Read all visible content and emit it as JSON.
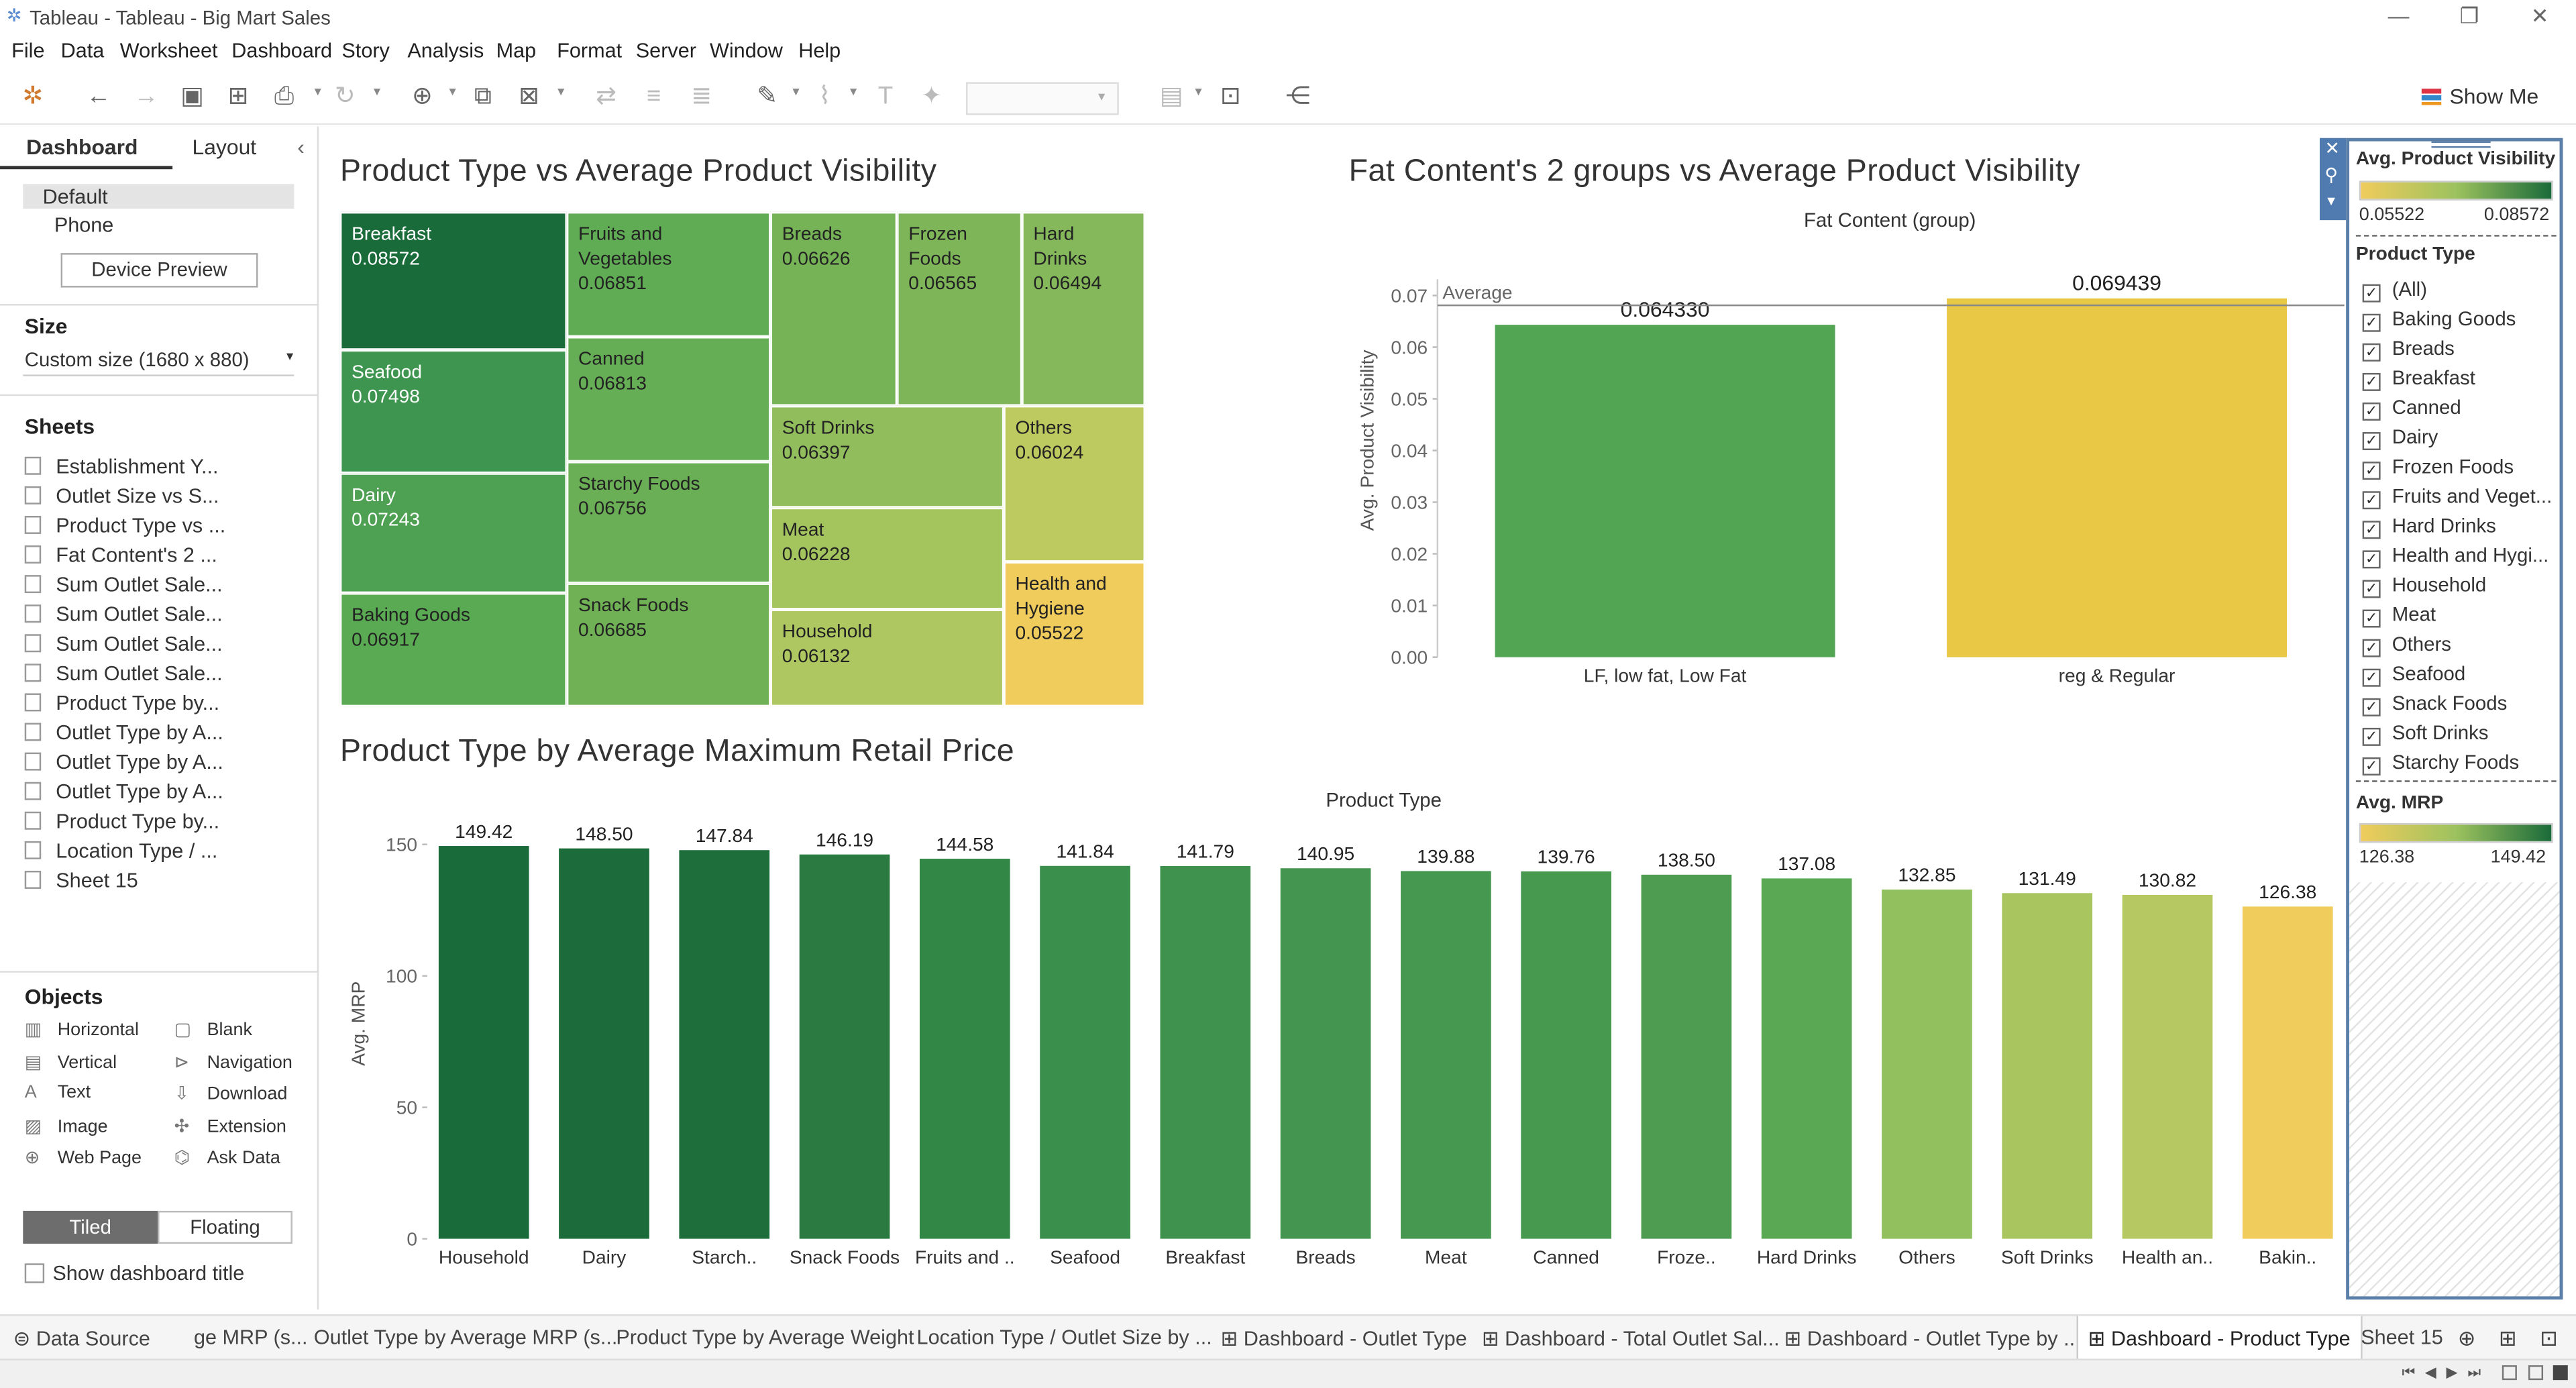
{
  "window": {
    "title": "Tableau - Tableau - Big Mart Sales"
  },
  "menu": [
    "File",
    "Data",
    "Worksheet",
    "Dashboard",
    "Story",
    "Analysis",
    "Map",
    "Format",
    "Server",
    "Window",
    "Help"
  ],
  "toolbar": {
    "show_me": "Show Me"
  },
  "left_panel": {
    "tabs": {
      "dashboard": "Dashboard",
      "layout": "Layout"
    },
    "devices": {
      "default": "Default",
      "phone": "Phone",
      "preview_button": "Device Preview"
    },
    "size": {
      "heading": "Size",
      "value": "Custom size (1680 x 880)"
    },
    "sheets_heading": "Sheets",
    "sheets": [
      "Establishment Y...",
      "Outlet Size vs S...",
      "Product Type vs ...",
      "Fat Content's 2 ...",
      "Sum Outlet Sale...",
      "Sum Outlet Sale...",
      "Sum Outlet Sale...",
      "Sum Outlet Sale...",
      "Product Type by...",
      "Outlet Type by A...",
      "Outlet Type by A...",
      "Outlet Type by A...",
      "Product Type by...",
      "Location Type / ...",
      "Sheet 15"
    ],
    "objects_heading": "Objects",
    "objects": [
      {
        "label": "Horizontal",
        "icon": "horizontal-icon"
      },
      {
        "label": "Blank",
        "icon": "blank-icon"
      },
      {
        "label": "Vertical",
        "icon": "vertical-icon"
      },
      {
        "label": "Navigation",
        "icon": "navigation-icon"
      },
      {
        "label": "Text",
        "icon": "text-icon"
      },
      {
        "label": "Download",
        "icon": "download-icon"
      },
      {
        "label": "Image",
        "icon": "image-icon"
      },
      {
        "label": "Extension",
        "icon": "extension-icon"
      },
      {
        "label": "Web Page",
        "icon": "globe-icon"
      },
      {
        "label": "Ask Data",
        "icon": "ask-data-icon"
      }
    ],
    "tiled": "Tiled",
    "floating": "Floating",
    "show_title": "Show dashboard title"
  },
  "treemap": {
    "title": "Product Type vs Average Product Visibility",
    "cells": [
      {
        "name": "Breakfast",
        "value": "0.08572",
        "color": "#1a6b3a",
        "lines": [
          "Breakfast"
        ]
      },
      {
        "name": "Seafood",
        "value": "0.07498",
        "color": "#3e9550",
        "lines": [
          "Seafood"
        ]
      },
      {
        "name": "Dairy",
        "value": "0.07243",
        "color": "#4ea052",
        "lines": [
          "Dairy"
        ]
      },
      {
        "name": "Baking Goods",
        "value": "0.06917",
        "color": "#5aa953",
        "lines": [
          "Baking Goods"
        ]
      },
      {
        "name": "Fruits and Vegetables",
        "value": "0.06851",
        "color": "#60ac54",
        "lines": [
          "Fruits and",
          "Vegetables"
        ]
      },
      {
        "name": "Canned",
        "value": "0.06813",
        "color": "#65ae55",
        "lines": [
          "Canned"
        ]
      },
      {
        "name": "Starchy Foods",
        "value": "0.06756",
        "color": "#6aaf55",
        "lines": [
          "Starchy Foods"
        ]
      },
      {
        "name": "Snack Foods",
        "value": "0.06685",
        "color": "#70b156",
        "lines": [
          "Snack Foods"
        ]
      },
      {
        "name": "Breads",
        "value": "0.06626",
        "color": "#76b357",
        "lines": [
          "Breads"
        ]
      },
      {
        "name": "Frozen Foods",
        "value": "0.06565",
        "color": "#7db558",
        "lines": [
          "Frozen",
          "Foods"
        ]
      },
      {
        "name": "Hard Drinks",
        "value": "0.06494",
        "color": "#85b85a",
        "lines": [
          "Hard",
          "Drinks"
        ]
      },
      {
        "name": "Soft Drinks",
        "value": "0.06397",
        "color": "#92bd5c",
        "lines": [
          "Soft Drinks"
        ]
      },
      {
        "name": "Meat",
        "value": "0.06228",
        "color": "#a4c45e",
        "lines": [
          "Meat"
        ]
      },
      {
        "name": "Household",
        "value": "0.06132",
        "color": "#aec760",
        "lines": [
          "Household"
        ]
      },
      {
        "name": "Others",
        "value": "0.06024",
        "color": "#bcca5f",
        "lines": [
          "Others"
        ]
      },
      {
        "name": "Health and Hygiene",
        "value": "0.05522",
        "color": "#f0cc5c",
        "lines": [
          "Health and",
          "Hygiene"
        ]
      }
    ]
  },
  "fat_chart": {
    "title": "Fat Content's 2 groups vs Average Product Visibility",
    "header": "Fat Content (group)",
    "ylabel": "Avg. Product Visibility",
    "average_label": "Average",
    "y_ticks": [
      "0.07",
      "0.06",
      "0.05",
      "0.04",
      "0.03",
      "0.02",
      "0.01",
      "0.00"
    ],
    "colors": {
      "low": "#52a553",
      "reg": "#e9c846"
    }
  },
  "mrp_chart": {
    "title": "Product Type by Average Maximum Retail Price",
    "header": "Product Type",
    "ylabel": "Avg. MRP",
    "y_ticks": [
      "150",
      "100",
      "50",
      "0"
    ],
    "colors": [
      "#1a6b3a",
      "#1b6c3a",
      "#1d6e3b",
      "#2a7a42",
      "#328646",
      "#3b8f4c",
      "#3f924e",
      "#43954f",
      "#469850",
      "#489950",
      "#4d9c51",
      "#5aa853",
      "#93c05e",
      "#a8c55f",
      "#b6c862",
      "#f0cc5c"
    ]
  },
  "chart_data": [
    {
      "type": "treemap",
      "title": "Product Type vs Average Product Visibility",
      "categories": [
        "Breakfast",
        "Seafood",
        "Dairy",
        "Baking Goods",
        "Fruits and Vegetables",
        "Canned",
        "Starchy Foods",
        "Snack Foods",
        "Breads",
        "Frozen Foods",
        "Hard Drinks",
        "Soft Drinks",
        "Meat",
        "Household",
        "Others",
        "Health and Hygiene"
      ],
      "values": [
        0.08572,
        0.07498,
        0.07243,
        0.06917,
        0.06851,
        0.06813,
        0.06756,
        0.06685,
        0.06626,
        0.06565,
        0.06494,
        0.06397,
        0.06228,
        0.06132,
        0.06024,
        0.05522
      ]
    },
    {
      "type": "bar",
      "title": "Fat Content's 2 groups vs Average Product Visibility",
      "xlabel": "Fat Content (group)",
      "ylabel": "Avg. Product Visibility",
      "categories": [
        "LF, low fat, Low Fat",
        "reg & Regular"
      ],
      "values": [
        0.06433,
        0.069439
      ],
      "labels": [
        "0.064330",
        "0.069439"
      ],
      "reference_line": {
        "label": "Average",
        "value": 0.0681
      },
      "ylim": [
        0,
        0.0725
      ]
    },
    {
      "type": "bar",
      "title": "Product Type by Average Maximum Retail Price",
      "xlabel": "Product Type",
      "ylabel": "Avg. MRP",
      "categories": [
        "Household",
        "Dairy",
        "Starch..",
        "Snack Foods",
        "Fruits and ..",
        "Seafood",
        "Breakfast",
        "Breads",
        "Meat",
        "Canned",
        "Froze..",
        "Hard Drinks",
        "Others",
        "Soft Drinks",
        "Health an..",
        "Bakin.."
      ],
      "values": [
        149.42,
        148.5,
        147.84,
        146.19,
        144.58,
        141.84,
        141.79,
        140.95,
        139.88,
        139.76,
        138.5,
        137.08,
        132.85,
        131.49,
        130.82,
        126.38
      ],
      "labels": [
        "149.42",
        "148.50",
        "147.84",
        "146.19",
        "144.58",
        "141.84",
        "141.79",
        "140.95",
        "139.88",
        "139.76",
        "138.50",
        "137.08",
        "132.85",
        "131.49",
        "130.82",
        "126.38"
      ],
      "ylim": [
        0,
        155
      ]
    }
  ],
  "legends": {
    "visibility": {
      "title": "Avg. Product Visibility",
      "min": "0.05522",
      "max": "0.08572"
    },
    "filter": {
      "title": "Product Type",
      "items": [
        "(All)",
        "Baking Goods",
        "Breads",
        "Breakfast",
        "Canned",
        "Dairy",
        "Frozen Foods",
        "Fruits and Veget...",
        "Hard Drinks",
        "Health and Hygi...",
        "Household",
        "Meat",
        "Others",
        "Seafood",
        "Snack Foods",
        "Soft Drinks",
        "Starchy Foods"
      ]
    },
    "mrp": {
      "title": "Avg. MRP",
      "min": "126.38",
      "max": "149.42"
    }
  },
  "bottom_tabs": {
    "data_source": "Data Source",
    "tabs": [
      "ge MRP (s...",
      "Outlet Type by Average MRP (s...",
      "Product Type by Average Weight",
      "Location Type / Outlet Size by ...",
      "Dashboard - Outlet Type",
      "Dashboard - Total Outlet Sal...",
      "Dashboard - Outlet Type by ...",
      "Dashboard - Product Type",
      "Sheet 15"
    ]
  }
}
